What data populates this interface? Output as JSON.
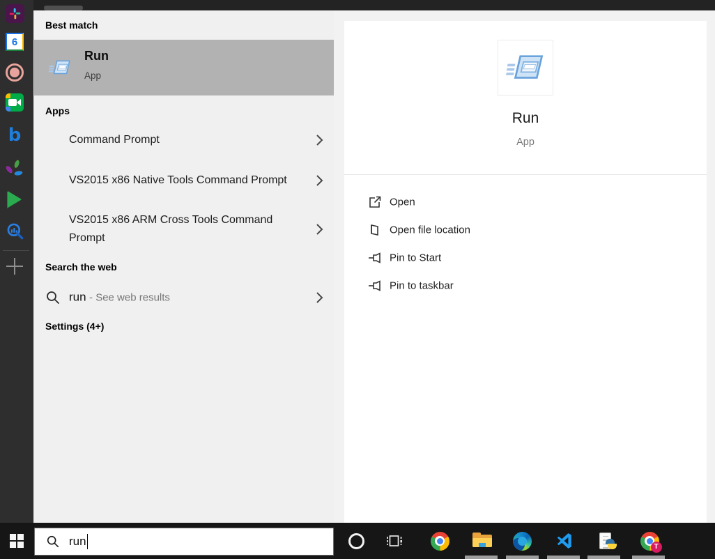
{
  "colors": {
    "selected_row_bg": "#b2b2b2",
    "dock_bg": "#2e2e2e",
    "taskbar_bg": "#161616",
    "flyout_left_bg": "#f0f0f0",
    "flyout_right_bg": "#f2f2f2",
    "card_bg": "#ffffff",
    "run_icon_blue": "#6aa3dc"
  },
  "sidebar": {
    "icons": [
      "slack-icon",
      "calendar-icon",
      "record-icon",
      "meet-icon",
      "bing-icon",
      "pinwheel-photos-icon",
      "play-icon",
      "search-analytics-icon",
      "add-icon"
    ],
    "calendar_day": "6",
    "bing_letter": "b"
  },
  "search_flyout": {
    "best_match_header": "Best match",
    "best_match": {
      "title": "Run",
      "type": "App"
    },
    "apps_header": "Apps",
    "apps": [
      {
        "label": "Command Prompt"
      },
      {
        "label": "VS2015 x86 Native Tools Command Prompt"
      },
      {
        "label": "VS2015 x86 ARM Cross Tools Command Prompt"
      }
    ],
    "web_header": "Search the web",
    "web_item": {
      "query": "run",
      "hint": "- See web results"
    },
    "settings_header": "Settings (4+)"
  },
  "preview": {
    "title": "Run",
    "type": "App",
    "actions": [
      {
        "label": "Open"
      },
      {
        "label": "Open file location"
      },
      {
        "label": "Pin to Start"
      },
      {
        "label": "Pin to taskbar"
      }
    ]
  },
  "taskbar": {
    "search_value": "run",
    "profile_badge": "T",
    "icons": [
      "start-button",
      "search-box",
      "cortana-icon",
      "task-view-icon",
      "chrome-icon",
      "file-explorer-icon",
      "edge-icon",
      "vscode-icon",
      "notepad-python-icon",
      "chrome-profile-icon"
    ]
  }
}
